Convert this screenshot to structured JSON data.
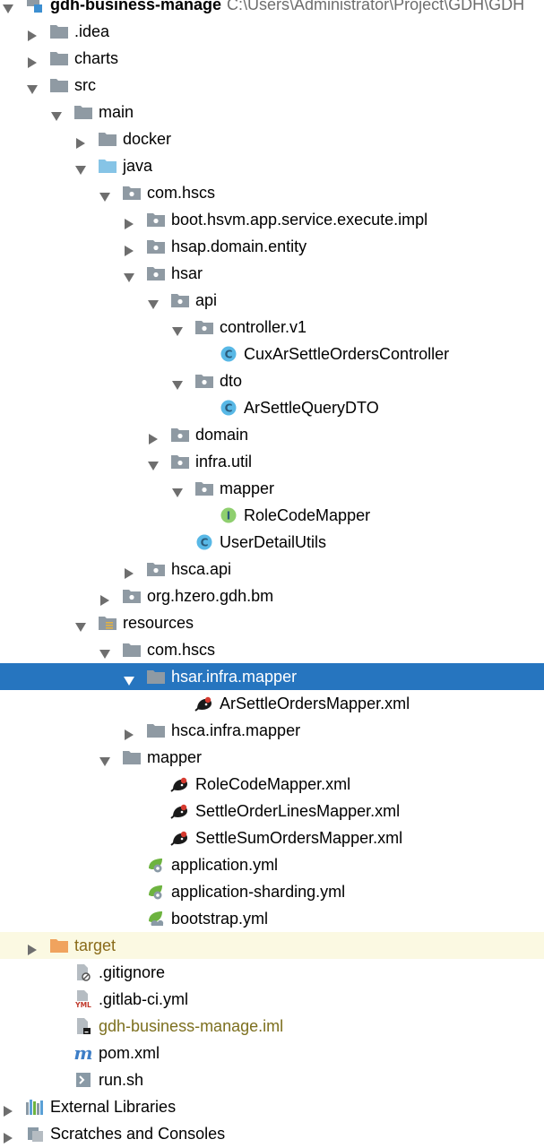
{
  "project_tree": {
    "colors": {
      "folder": "#8f9aa3",
      "folder_blue": "#86c4e6",
      "folder_orange": "#f0a35e",
      "selected_bg": "#2675bf",
      "class_icon": "#58b8e6",
      "interface_icon": "#8fcf6f",
      "excluded_bg": "#fbf9e2"
    },
    "rows": [
      {
        "depth": 0,
        "arrow": "down",
        "icon": "module-icon",
        "label": "gdh-business-manage",
        "path": "C:\\Users\\Administrator\\Project\\GDH\\GDH",
        "bold": true
      },
      {
        "depth": 1,
        "arrow": "right",
        "icon": "folder-icon",
        "label": ".idea"
      },
      {
        "depth": 1,
        "arrow": "right",
        "icon": "folder-icon",
        "label": "charts"
      },
      {
        "depth": 1,
        "arrow": "down",
        "icon": "folder-icon",
        "label": "src"
      },
      {
        "depth": 2,
        "arrow": "down",
        "icon": "folder-icon",
        "label": "main"
      },
      {
        "depth": 3,
        "arrow": "right",
        "icon": "folder-icon",
        "label": "docker"
      },
      {
        "depth": 3,
        "arrow": "down",
        "icon": "source-folder-icon",
        "label": "java"
      },
      {
        "depth": 4,
        "arrow": "down",
        "icon": "package-icon",
        "label": "com.hscs"
      },
      {
        "depth": 5,
        "arrow": "right",
        "icon": "package-icon",
        "label": "boot.hsvm.app.service.execute.impl"
      },
      {
        "depth": 5,
        "arrow": "right",
        "icon": "package-icon",
        "label": "hsap.domain.entity"
      },
      {
        "depth": 5,
        "arrow": "down",
        "icon": "package-icon",
        "label": "hsar"
      },
      {
        "depth": 6,
        "arrow": "down",
        "icon": "package-icon",
        "label": "api"
      },
      {
        "depth": 7,
        "arrow": "down",
        "icon": "package-icon",
        "label": "controller.v1"
      },
      {
        "depth": 8,
        "arrow": "none",
        "icon": "class-icon",
        "label": "CuxArSettleOrdersController"
      },
      {
        "depth": 7,
        "arrow": "down",
        "icon": "package-icon",
        "label": "dto"
      },
      {
        "depth": 8,
        "arrow": "none",
        "icon": "class-icon",
        "label": "ArSettleQueryDTO"
      },
      {
        "depth": 6,
        "arrow": "right",
        "icon": "package-icon",
        "label": "domain"
      },
      {
        "depth": 6,
        "arrow": "down",
        "icon": "package-icon",
        "label": "infra.util"
      },
      {
        "depth": 7,
        "arrow": "down",
        "icon": "package-icon",
        "label": "mapper"
      },
      {
        "depth": 8,
        "arrow": "none",
        "icon": "interface-icon",
        "label": "RoleCodeMapper"
      },
      {
        "depth": 7,
        "arrow": "none",
        "icon": "class-icon",
        "label": "UserDetailUtils"
      },
      {
        "depth": 5,
        "arrow": "right",
        "icon": "package-icon",
        "label": "hsca.api"
      },
      {
        "depth": 4,
        "arrow": "right",
        "icon": "package-icon",
        "label": "org.hzero.gdh.bm"
      },
      {
        "depth": 3,
        "arrow": "down",
        "icon": "resources-folder-icon",
        "label": "resources"
      },
      {
        "depth": 4,
        "arrow": "down",
        "icon": "folder-icon",
        "label": "com.hscs"
      },
      {
        "depth": 5,
        "arrow": "down",
        "icon": "folder-icon",
        "label": "hsar.infra.mapper",
        "selected": true
      },
      {
        "depth": 7,
        "arrow": "none",
        "icon": "mybatis-xml-icon",
        "label": "ArSettleOrdersMapper.xml"
      },
      {
        "depth": 5,
        "arrow": "right",
        "icon": "folder-icon",
        "label": "hsca.infra.mapper"
      },
      {
        "depth": 4,
        "arrow": "down",
        "icon": "folder-icon",
        "label": "mapper"
      },
      {
        "depth": 6,
        "arrow": "none",
        "icon": "mybatis-xml-icon",
        "label": "RoleCodeMapper.xml"
      },
      {
        "depth": 6,
        "arrow": "none",
        "icon": "mybatis-xml-icon",
        "label": "SettleOrderLinesMapper.xml"
      },
      {
        "depth": 6,
        "arrow": "none",
        "icon": "mybatis-xml-icon",
        "label": "SettleSumOrdersMapper.xml"
      },
      {
        "depth": 5,
        "arrow": "none",
        "icon": "spring-config-icon",
        "label": "application.yml"
      },
      {
        "depth": 5,
        "arrow": "none",
        "icon": "spring-config-icon",
        "label": "application-sharding.yml"
      },
      {
        "depth": 5,
        "arrow": "none",
        "icon": "spring-bootstrap-icon",
        "label": "bootstrap.yml"
      },
      {
        "depth": 1,
        "arrow": "right",
        "icon": "excluded-folder-icon",
        "label": "target",
        "style": "brown",
        "highlight": true
      },
      {
        "depth": 2,
        "arrow": "none",
        "icon": "gitignore-icon",
        "label": ".gitignore"
      },
      {
        "depth": 2,
        "arrow": "none",
        "icon": "yml-file-icon",
        "label": ".gitlab-ci.yml"
      },
      {
        "depth": 2,
        "arrow": "none",
        "icon": "iml-file-icon",
        "label": "gdh-business-manage.iml",
        "style": "olive"
      },
      {
        "depth": 2,
        "arrow": "none",
        "icon": "maven-icon",
        "label": "pom.xml"
      },
      {
        "depth": 2,
        "arrow": "none",
        "icon": "shell-script-icon",
        "label": "run.sh"
      },
      {
        "depth": 0,
        "arrow": "right",
        "icon": "external-libraries-icon",
        "label": "External Libraries"
      },
      {
        "depth": 0,
        "arrow": "right",
        "icon": "scratches-icon",
        "label": "Scratches and Consoles"
      }
    ]
  }
}
